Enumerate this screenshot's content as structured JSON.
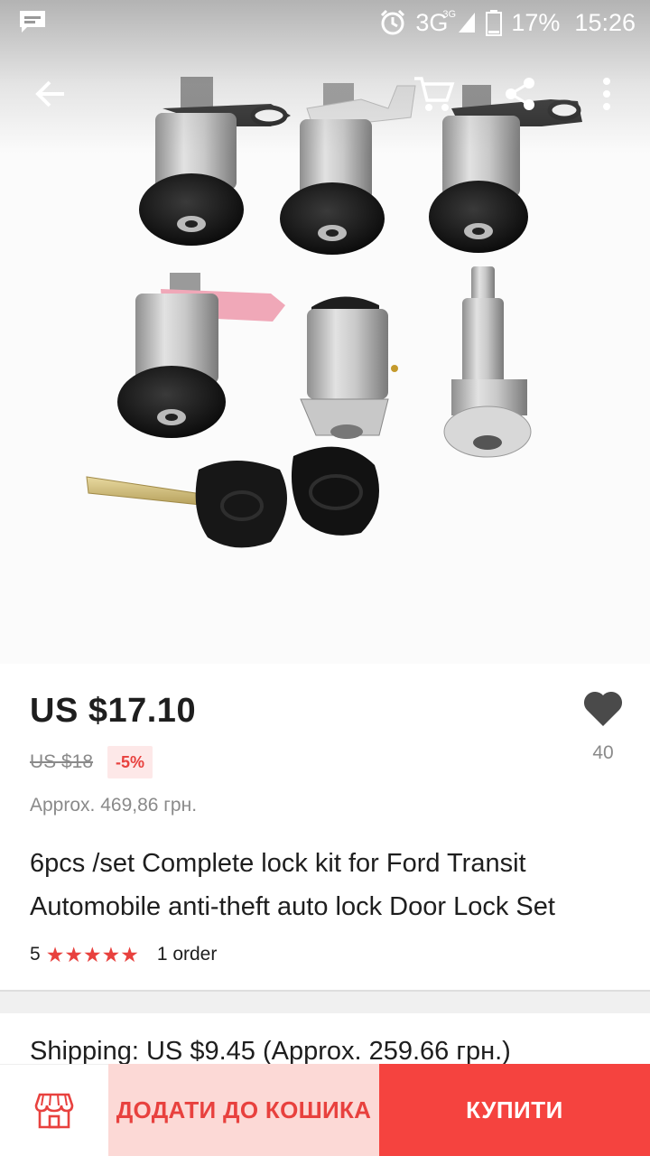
{
  "status_bar": {
    "network": "3G",
    "network_sup": "3G",
    "battery": "17%",
    "time": "15:26",
    "icons": [
      "message-icon",
      "alarm-icon",
      "signal-icon",
      "battery-icon"
    ]
  },
  "toolbar": {
    "icons": [
      "back-arrow-icon",
      "cart-icon",
      "share-icon",
      "more-vert-icon"
    ]
  },
  "product": {
    "price": "US $17.10",
    "old_price": "US $18",
    "discount": "-5%",
    "approx_price": "Approx. 469,86 грн.",
    "wishlist_count": "40",
    "title": "6pcs /set Complete lock kit for Ford Transit Automobile anti-theft auto lock Door Lock Set",
    "rating_score": "5",
    "stars": 5,
    "orders": "1 order",
    "shipping": "Shipping: US $9.45 (Approx. 259.66 грн.)"
  },
  "bottom_bar": {
    "add_to_cart": "ДОДАТИ ДО КОШИКА",
    "buy": "КУПИТИ"
  },
  "colors": {
    "accent": "#f5433f",
    "accent_light": "#fcd9d6",
    "star": "#e8413e",
    "muted_text": "#8a8a8a"
  }
}
